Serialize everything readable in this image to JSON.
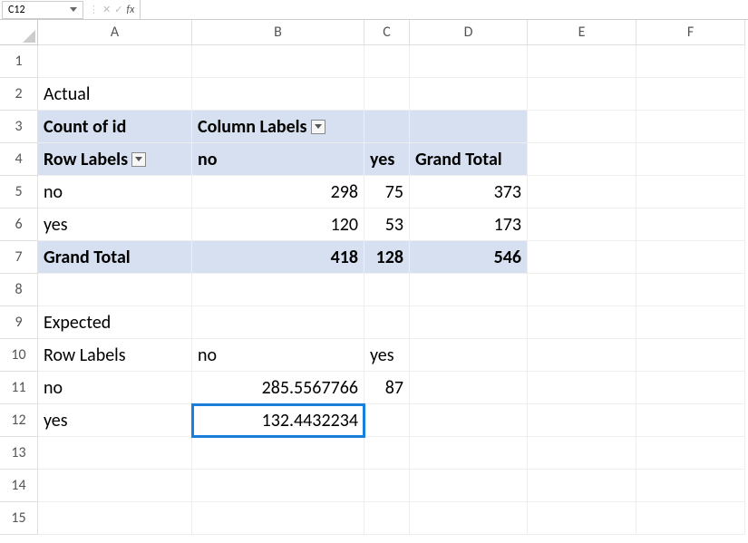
{
  "name_box": "C12",
  "fx": "fx",
  "formula_value": "",
  "columns": [
    "A",
    "B",
    "C",
    "D",
    "E",
    "F"
  ],
  "row_numbers": [
    "1",
    "2",
    "3",
    "4",
    "5",
    "6",
    "7",
    "8",
    "9",
    "10",
    "11",
    "12",
    "13",
    "14",
    "15"
  ],
  "cells": {
    "A2": "Actual",
    "A3": "Count of id",
    "B3": "Column Labels",
    "A4": "Row Labels",
    "B4": "no",
    "C4": "yes",
    "D4": "Grand Total",
    "A5": "no",
    "B5": "298",
    "C5": "75",
    "D5": "373",
    "A6": "yes",
    "B6": "120",
    "C6": "53",
    "D6": "173",
    "A7": "Grand Total",
    "B7": "418",
    "C7": "128",
    "D7": "546",
    "A9": "Expected",
    "A10": "Row Labels",
    "B10": "no",
    "C10": "yes",
    "A11": "no",
    "B11": "285.5567766",
    "C11": "87",
    "A12": "yes",
    "B12": "132.4432234"
  }
}
